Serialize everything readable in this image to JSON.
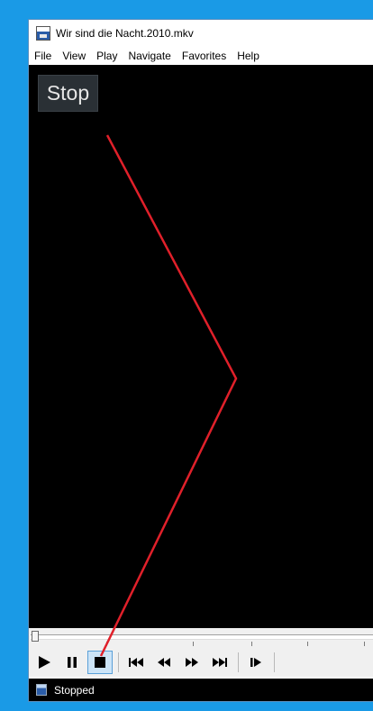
{
  "window": {
    "title": "Wir sind die Nacht.2010.mkv"
  },
  "menu": {
    "items": [
      "File",
      "View",
      "Play",
      "Navigate",
      "Favorites",
      "Help"
    ]
  },
  "osd": {
    "text": "Stop"
  },
  "seekbar": {
    "position_fraction": 0
  },
  "controls": {
    "play_icon": "play-icon",
    "pause_icon": "pause-icon",
    "stop_icon": "stop-icon",
    "prev_icon": "skip-previous-icon",
    "rewind_icon": "rewind-icon",
    "forward_icon": "fast-forward-icon",
    "next_icon": "skip-next-icon",
    "frame_step_icon": "frame-step-icon"
  },
  "status": {
    "text": "Stopped"
  },
  "colors": {
    "desktop": "#1a9ae6",
    "annotation_line": "#e0202a",
    "active_button": "#cce4f7"
  }
}
